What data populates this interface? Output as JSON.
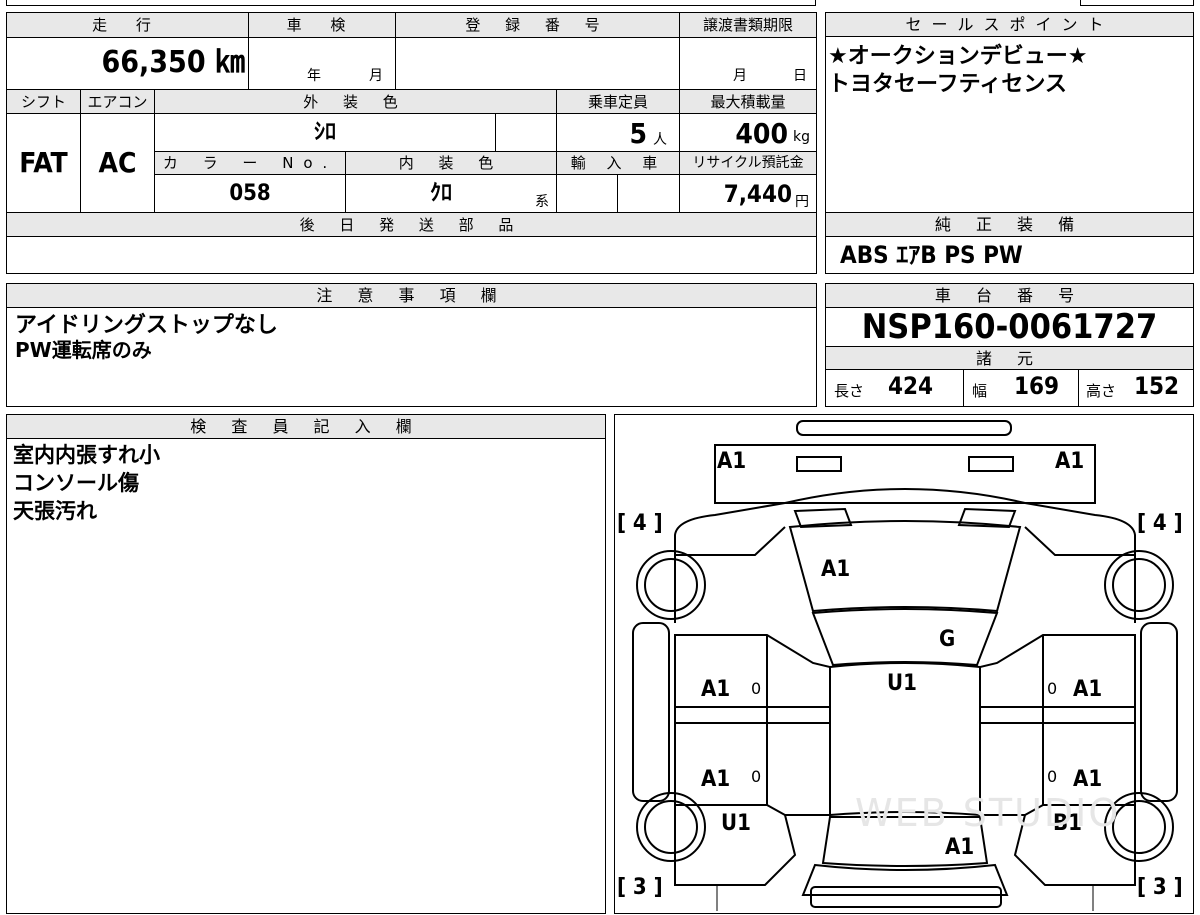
{
  "spec": {
    "mileage_header": "走 行",
    "mileage_value": "66,350 ㎞",
    "inspection_header": "車 検",
    "inspection_year_unit": "年",
    "inspection_month_unit": "月",
    "registration_header": "登 録 番 号",
    "transfer_header": "譲渡書類期限",
    "transfer_month_unit": "月",
    "transfer_day_unit": "日",
    "shift_header": "シフト",
    "shift_value": "FAT",
    "ac_header": "エアコン",
    "ac_value": "AC",
    "exterior_header": "外 装 色",
    "exterior_value": "ｼﾛ",
    "capacity_header": "乗車定員",
    "capacity_value": "5",
    "capacity_unit": "人",
    "max_load_header": "最大積載量",
    "max_load_value": "400",
    "max_load_unit": "kg",
    "color_no_header": "カ ラ ー No.",
    "color_no_value": "058",
    "interior_header": "内 装 色",
    "interior_value": "ｸﾛ",
    "interior_suffix": "系",
    "import_header": "輸 入 車",
    "recycle_header": "リサイクル預託金",
    "recycle_value": "7,440",
    "recycle_unit": "円",
    "later_parts_header": "後 日 発 送 部 品"
  },
  "sales_point": {
    "header": "セールスポイント",
    "lines": [
      "★オークションデビュー★",
      "トヨタセーフティセンス"
    ]
  },
  "equipment": {
    "header": "純 正 装 備",
    "value": "ABS ｴｱB PS PW"
  },
  "notes": {
    "header": "注 意 事 項 欄",
    "lines": [
      "アイドリングストップなし",
      "PW運転席のみ"
    ]
  },
  "chassis": {
    "header": "車 台 番 号",
    "value": "NSP160-0061727",
    "dims_header": "諸 元",
    "length_label": "長さ",
    "length_value": "424",
    "width_label": "幅",
    "width_value": "169",
    "height_label": "高さ",
    "height_value": "152"
  },
  "inspector": {
    "header": "検 査 員 記 入 欄",
    "lines": [
      "室内内張すれ小",
      "コンソール傷",
      "天張汚れ"
    ]
  },
  "diagram": {
    "bumper_left": "A1",
    "bumper_right": "A1",
    "bonnet": "A1",
    "windshield": "G",
    "roof": "U1",
    "front_door_left": "A1",
    "front_door_right": "A1",
    "rear_door_left": "A1",
    "rear_door_right": "A1",
    "rear_fender_left": "U1",
    "rear_fender_right": "B1",
    "trunk": "A1",
    "door_marks": "0",
    "tire_front_left": "[ 4 ]",
    "tire_front_right": "[ 4 ]",
    "tire_rear_left": "[ 3 ]",
    "tire_rear_right": "[ 3 ]",
    "watermark": "WEB STUDIO"
  }
}
